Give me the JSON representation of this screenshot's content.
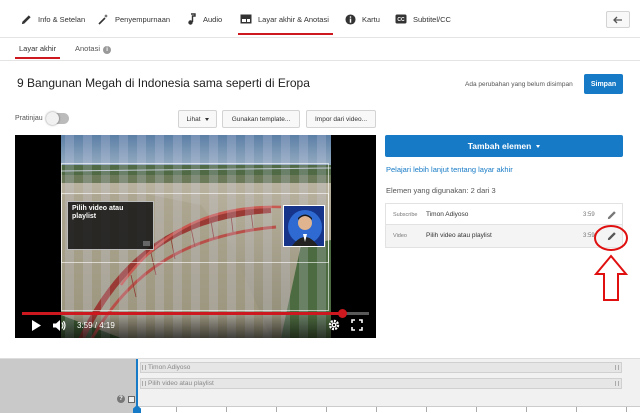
{
  "tabs": [
    {
      "label": "Info & Setelan",
      "icon": "pencil-icon"
    },
    {
      "label": "Penyempurnaan",
      "icon": "magic-wand-icon"
    },
    {
      "label": "Audio",
      "icon": "music-note-icon"
    },
    {
      "label": "Layar akhir & Anotasi",
      "icon": "end-screen-icon",
      "active": true
    },
    {
      "label": "Kartu",
      "icon": "info-card-icon"
    },
    {
      "label": "Subtitel/CC",
      "icon": "cc-icon"
    }
  ],
  "subtabs": [
    {
      "label": "Layar akhir",
      "active": true
    },
    {
      "label": "Anotasi",
      "icon": "info-icon"
    }
  ],
  "video_title": "9 Bangunan Megah di Indonesia sama seperti di Eropa",
  "unsaved_text": "Ada perubahan yang belum disimpan",
  "save_label": "Simpan",
  "preview_label": "Pratinjau",
  "toolbar": {
    "view_label": "Lihat",
    "template_label": "Gunakan template...",
    "import_label": "Impor dari video..."
  },
  "player": {
    "overlay_text": "Pilih video atau playlist",
    "timecode": "3:59 / 4:19",
    "progress": 0.923
  },
  "add_element_label": "Tambah elemen",
  "learn_more_link": "Pelajari lebih lanjut tentang layar akhir",
  "elements_used": "Elemen yang digunakan: 2 dari 3",
  "elements": [
    {
      "type": "Subscribe",
      "name": "Timon Adiyoso",
      "time": "3:59"
    },
    {
      "type": "Video",
      "name": "Pilih video atau playlist",
      "time": "3:59"
    }
  ],
  "timeline": {
    "tracks": [
      "Timon Adiyoso",
      "Pilih video atau playlist"
    ]
  },
  "colors": {
    "accent_red": "#cc181e",
    "accent_blue": "#167ac6"
  }
}
